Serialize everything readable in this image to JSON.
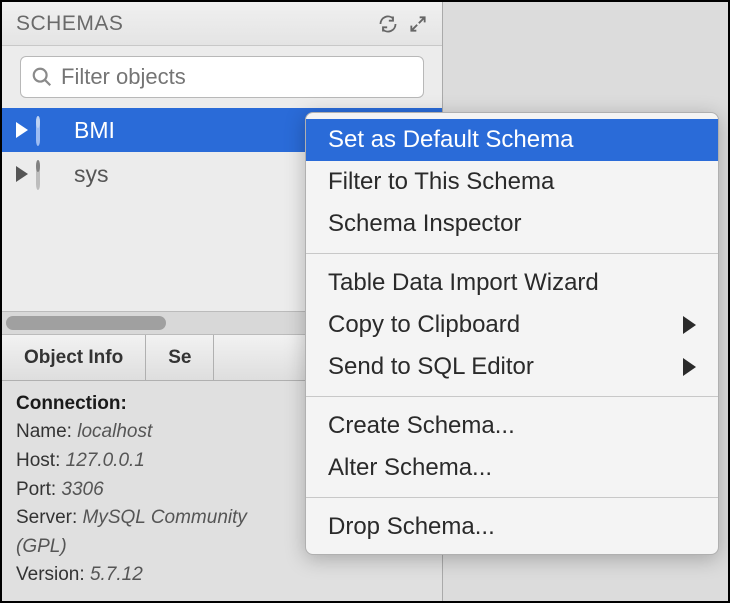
{
  "header": {
    "title": "SCHEMAS"
  },
  "filter": {
    "placeholder": "Filter objects"
  },
  "schemas": [
    {
      "name": "BMI",
      "selected": true
    },
    {
      "name": "sys",
      "selected": false
    }
  ],
  "tabs": [
    {
      "label": "Object Info"
    },
    {
      "label": "Se"
    }
  ],
  "connection": {
    "heading": "Connection:",
    "name_label": "Name:",
    "name_value": "localhost",
    "host_label": "Host:",
    "host_value": "127.0.0.1",
    "port_label": "Port:",
    "port_value": "3306",
    "server_label": "Server:",
    "server_value": "MySQL Community",
    "server_suffix": "(GPL)",
    "version_label": "Version:",
    "version_value": "5.7.12"
  },
  "context_menu": {
    "groups": [
      [
        {
          "label": "Set as Default Schema",
          "highlighted": true,
          "submenu": false
        },
        {
          "label": "Filter to This Schema",
          "highlighted": false,
          "submenu": false
        },
        {
          "label": "Schema Inspector",
          "highlighted": false,
          "submenu": false
        }
      ],
      [
        {
          "label": "Table Data Import Wizard",
          "highlighted": false,
          "submenu": false
        },
        {
          "label": "Copy to Clipboard",
          "highlighted": false,
          "submenu": true
        },
        {
          "label": "Send to SQL Editor",
          "highlighted": false,
          "submenu": true
        }
      ],
      [
        {
          "label": "Create Schema...",
          "highlighted": false,
          "submenu": false
        },
        {
          "label": "Alter Schema...",
          "highlighted": false,
          "submenu": false
        }
      ],
      [
        {
          "label": "Drop Schema...",
          "highlighted": false,
          "submenu": false
        }
      ]
    ]
  }
}
